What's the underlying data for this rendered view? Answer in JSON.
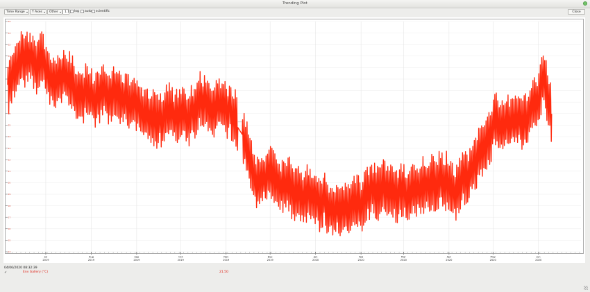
{
  "window": {
    "title": "Trending Plot"
  },
  "toolbar": {
    "time_range_label": "Time Range",
    "y_axes_label": "Y Axes",
    "other_label": "Other",
    "scale_value": "1.1",
    "log_label": "log",
    "auto_label": "auto",
    "scientific_label": "scientific",
    "close_label": "Close"
  },
  "status": {
    "cursor_timestamp": "04/06/2020 08:32:39"
  },
  "legend": {
    "check_glyph": "✓",
    "series_name": "Env Gallery (°C)",
    "series_value": "21.50"
  },
  "colors": {
    "series": "#ff2a0e",
    "accent": "#e0261b"
  },
  "chart_data": {
    "type": "line",
    "x_tick_labels": [
      {
        "month": "Jul",
        "year": "2019"
      },
      {
        "month": "Aug",
        "year": "2019"
      },
      {
        "month": "Sep",
        "year": "2019"
      },
      {
        "month": "Oct",
        "year": "2019"
      },
      {
        "month": "Nov",
        "year": "2019"
      },
      {
        "month": "Dec",
        "year": "2019"
      },
      {
        "month": "Jan",
        "year": "2020"
      },
      {
        "month": "Feb",
        "year": "2020"
      },
      {
        "month": "Mar",
        "year": "2020"
      },
      {
        "month": "Apr",
        "year": "2020"
      },
      {
        "month": "May",
        "year": "2020"
      },
      {
        "month": "Jun",
        "year": "2020"
      }
    ],
    "xlim": [
      "2019-06-05",
      "2020-06-30"
    ],
    "ylim": [
      14,
      34
    ],
    "grid": true,
    "series": [
      {
        "x": [
          "2019-06-05",
          "2019-06-12",
          "2019-06-20",
          "2019-06-28",
          "2019-07-06",
          "2019-07-14",
          "2019-07-22",
          "2019-07-30",
          "2019-08-07",
          "2019-08-15",
          "2019-08-23",
          "2019-08-31",
          "2019-09-08",
          "2019-09-16",
          "2019-09-24",
          "2019-10-02",
          "2019-10-10",
          "2019-10-18",
          "2019-10-26",
          "2019-11-03",
          "2019-11-08",
          "2019-11-12",
          "2019-11-20",
          "2019-11-28",
          "2019-12-06",
          "2019-12-14",
          "2019-12-22",
          "2019-12-30",
          "2020-01-07",
          "2020-01-15",
          "2020-01-23",
          "2020-01-31",
          "2020-02-08",
          "2020-02-16",
          "2020-02-24",
          "2020-03-03",
          "2020-03-11",
          "2020-03-19",
          "2020-03-27",
          "2020-04-04",
          "2020-04-12",
          "2020-04-20",
          "2020-04-28",
          "2020-05-06",
          "2020-05-14",
          "2020-05-22",
          "2020-05-30",
          "2020-06-05",
          "2020-06-10"
        ],
        "y": [
          28.5,
          30.5,
          31.5,
          30.5,
          29,
          29.5,
          28.5,
          28,
          27.5,
          28,
          27.5,
          26.5,
          26,
          25.5,
          26,
          25.5,
          26,
          27,
          27,
          26.5,
          25.5,
          24.6,
          20.2,
          20.5,
          20,
          19.5,
          19,
          19,
          18.5,
          18,
          17.5,
          18,
          19.5,
          19.5,
          19.5,
          19,
          19.5,
          20,
          20.5,
          19.5,
          20.5,
          22,
          24,
          25,
          25.5,
          25.5,
          27,
          28.5,
          26.5
        ]
      }
    ]
  }
}
